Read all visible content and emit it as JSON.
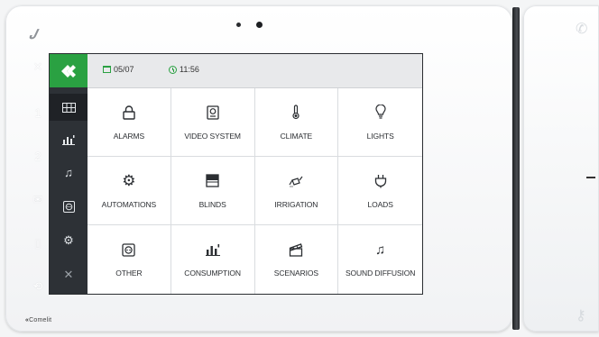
{
  "statusbar": {
    "date": "05/07",
    "time": "11:56",
    "accent_color": "#2aa142"
  },
  "brand": {
    "label": "Comelit"
  },
  "left_nav": [
    {
      "icon": "comelit-logo-icon"
    },
    {
      "icon": "grid-icon",
      "selected": true
    },
    {
      "icon": "consumption-icon"
    },
    {
      "icon": "music-icon"
    },
    {
      "icon": "socket-icon"
    },
    {
      "icon": "automation-icon"
    },
    {
      "icon": "tools-icon"
    }
  ],
  "tiles": [
    {
      "label": "ALARMS",
      "icon": "lock-icon"
    },
    {
      "label": "VIDEO SYSTEM",
      "icon": "intercom-icon"
    },
    {
      "label": "CLIMATE",
      "icon": "thermometer-icon"
    },
    {
      "label": "LIGHTS",
      "icon": "bulb-icon"
    },
    {
      "label": "AUTOMATIONS",
      "icon": "automation-gear-icon"
    },
    {
      "label": "BLINDS",
      "icon": "blinds-icon"
    },
    {
      "label": "IRRIGATION",
      "icon": "watering-can-icon"
    },
    {
      "label": "LOADS",
      "icon": "plug-icon"
    },
    {
      "label": "OTHER",
      "icon": "socket-icon"
    },
    {
      "label": "CONSUMPTION",
      "icon": "bar-chart-icon"
    },
    {
      "label": "SCENARIOS",
      "icon": "clapperboard-icon"
    },
    {
      "label": "SOUND DIFFUSION",
      "icon": "music-notes-icon"
    }
  ]
}
